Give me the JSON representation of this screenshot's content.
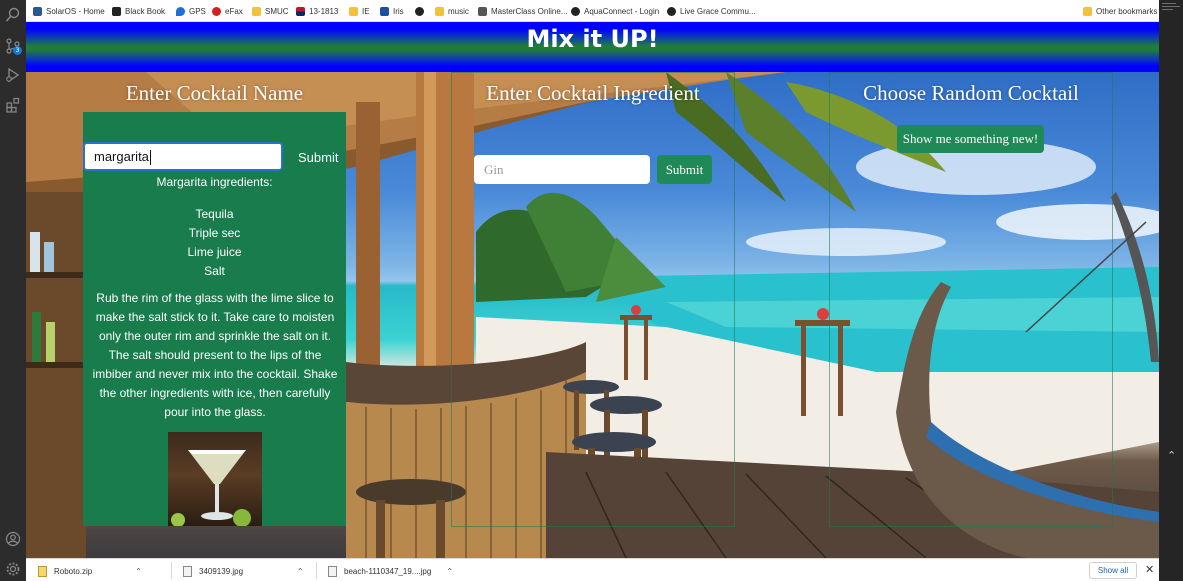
{
  "bookmarks": [
    {
      "label": "SolarOS - Home",
      "icon": "grid-icon",
      "color": "#2b5797"
    },
    {
      "label": "Black Book",
      "icon": "bb-logo-icon",
      "color": "#222222"
    },
    {
      "label": "GPS",
      "icon": "map-pin-icon",
      "color": "#1e6fd9"
    },
    {
      "label": "eFax",
      "icon": "efax-logo-icon",
      "color": "#d02020"
    },
    {
      "label": "SMUC",
      "icon": "folder-icon",
      "color": "#f2c23a"
    },
    {
      "label": "13-1813",
      "icon": "arizona-flag-icon",
      "color": "#c8102e"
    },
    {
      "label": "IE",
      "icon": "folder-icon",
      "color": "#f2c23a"
    },
    {
      "label": "Iris",
      "icon": "iris-logo-icon",
      "color": "#1c4fa1"
    },
    {
      "label": "",
      "icon": "globe-icon",
      "color": "#222222"
    },
    {
      "label": "music",
      "icon": "folder-icon",
      "color": "#f2c23a"
    },
    {
      "label": "MasterClass Online...",
      "icon": "masterclass-logo-icon",
      "color": "#333333"
    },
    {
      "label": "AquaConnect - Login",
      "icon": "globe-icon",
      "color": "#222222"
    },
    {
      "label": "Live Grace Commu...",
      "icon": "globe-icon",
      "color": "#222222"
    }
  ],
  "other_bookmarks": "Other bookmarks",
  "app": {
    "title": "Mix it UP!",
    "columns": {
      "name_title": "Enter Cocktail Name",
      "ingredient_title": "Enter Cocktail Ingredient",
      "random_title": "Choose Random Cocktail"
    },
    "name_search": {
      "value": "margarita",
      "submit_label": "Submit"
    },
    "result": {
      "heading": "Margarita ingredients:",
      "ingredients": [
        "Tequila",
        "Triple sec",
        "Lime juice",
        "Salt"
      ],
      "instructions": "Rub the rim of the glass with the lime slice to make the salt stick to it. Take care to moisten only the outer rim and sprinkle the salt on it. The salt should present to the lips of the imbiber and never mix into the cocktail. Shake the other ingredients with ice, then carefully pour into the glass."
    },
    "ingredient_search": {
      "placeholder": "Gin",
      "submit_label": "Submit"
    },
    "random_button_label": "Show me something new!"
  },
  "downloads": [
    {
      "name": "Roboto.zip"
    },
    {
      "name": "3409139.jpg"
    },
    {
      "name": "beach-1110347_19....jpg"
    }
  ],
  "show_all_label": "Show all",
  "colors": {
    "card_green": "#187c4c",
    "button_green": "#1f8a57",
    "header_blue": "#0000ff",
    "input_focus": "#2a6fd6"
  }
}
